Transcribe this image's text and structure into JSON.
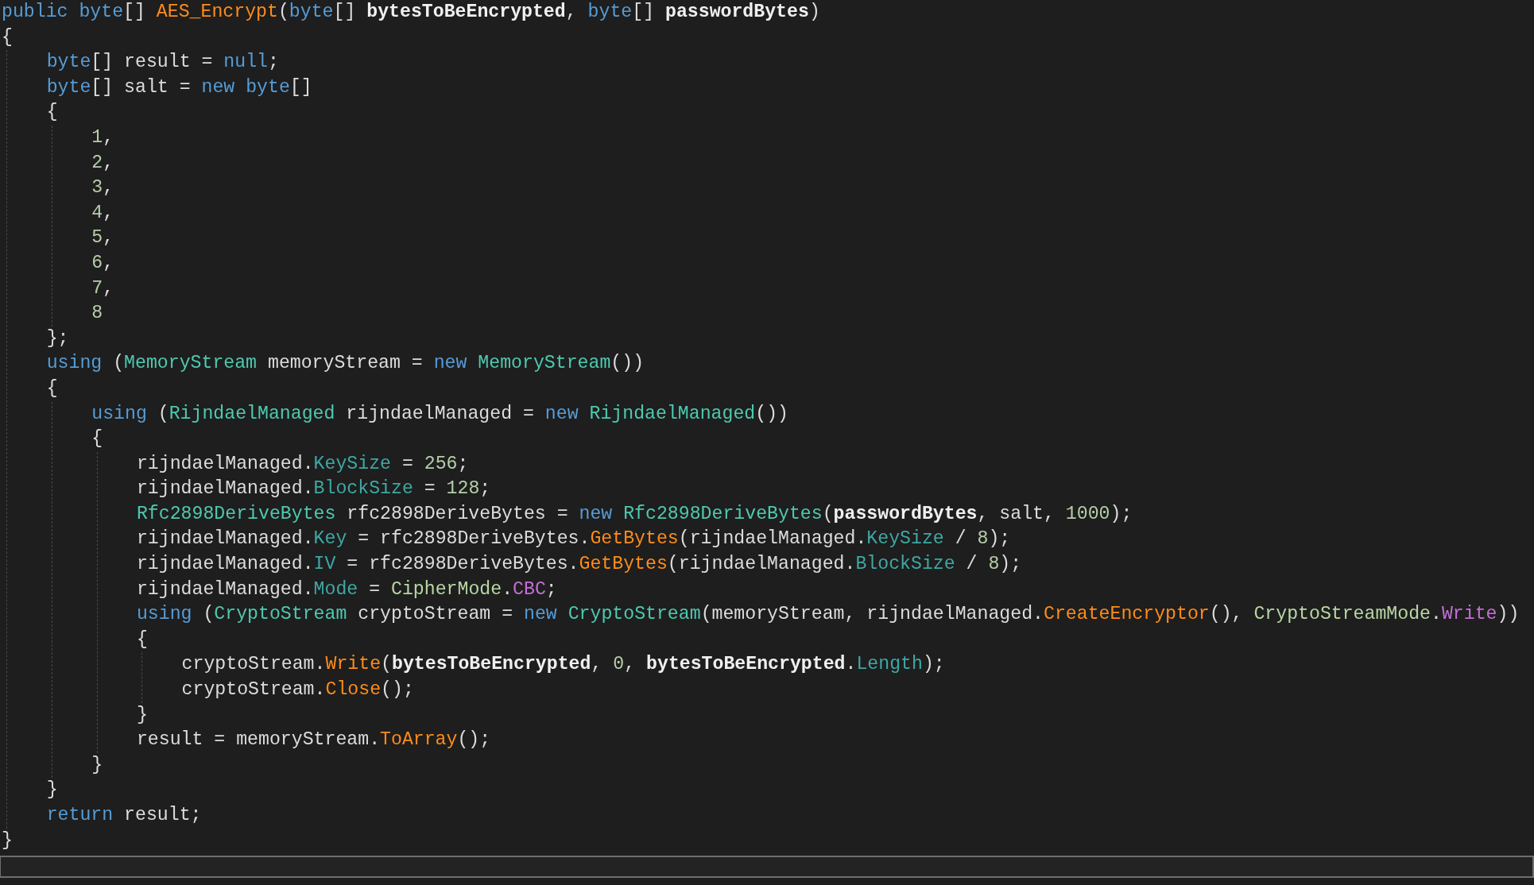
{
  "editor": {
    "lines": [
      {
        "tokens": [
          {
            "kind": "kw",
            "text": "public "
          },
          {
            "kind": "kw",
            "text": "byte"
          },
          {
            "kind": "text",
            "text": "[] "
          },
          {
            "kind": "fn",
            "text": "AES_Encrypt"
          },
          {
            "kind": "text",
            "text": "("
          },
          {
            "kind": "kw",
            "text": "byte"
          },
          {
            "kind": "text",
            "text": "[] "
          },
          {
            "kind": "param",
            "text": "bytesToBeEncrypted"
          },
          {
            "kind": "text",
            "text": ", "
          },
          {
            "kind": "kw",
            "text": "byte"
          },
          {
            "kind": "text",
            "text": "[] "
          },
          {
            "kind": "param",
            "text": "passwordBytes"
          },
          {
            "kind": "text",
            "text": ")"
          }
        ]
      },
      {
        "tokens": [
          {
            "kind": "text",
            "text": "{"
          }
        ],
        "children": [
          {
            "tokens": [
              {
                "kind": "kw",
                "text": "byte"
              },
              {
                "kind": "text",
                "text": "[] result = "
              },
              {
                "kind": "kw",
                "text": "null"
              },
              {
                "kind": "text",
                "text": ";"
              }
            ]
          },
          {
            "tokens": [
              {
                "kind": "kw",
                "text": "byte"
              },
              {
                "kind": "text",
                "text": "[] salt = "
              },
              {
                "kind": "kw",
                "text": "new "
              },
              {
                "kind": "kw",
                "text": "byte"
              },
              {
                "kind": "text",
                "text": "[]"
              }
            ]
          },
          {
            "tokens": [
              {
                "kind": "text",
                "text": "{"
              }
            ],
            "children": [
              {
                "tokens": [
                  {
                    "kind": "num",
                    "text": "1"
                  },
                  {
                    "kind": "text",
                    "text": ","
                  }
                ]
              },
              {
                "tokens": [
                  {
                    "kind": "num",
                    "text": "2"
                  },
                  {
                    "kind": "text",
                    "text": ","
                  }
                ]
              },
              {
                "tokens": [
                  {
                    "kind": "num",
                    "text": "3"
                  },
                  {
                    "kind": "text",
                    "text": ","
                  }
                ]
              },
              {
                "tokens": [
                  {
                    "kind": "num",
                    "text": "4"
                  },
                  {
                    "kind": "text",
                    "text": ","
                  }
                ]
              },
              {
                "tokens": [
                  {
                    "kind": "num",
                    "text": "5"
                  },
                  {
                    "kind": "text",
                    "text": ","
                  }
                ]
              },
              {
                "tokens": [
                  {
                    "kind": "num",
                    "text": "6"
                  },
                  {
                    "kind": "text",
                    "text": ","
                  }
                ]
              },
              {
                "tokens": [
                  {
                    "kind": "num",
                    "text": "7"
                  },
                  {
                    "kind": "text",
                    "text": ","
                  }
                ]
              },
              {
                "tokens": [
                  {
                    "kind": "num",
                    "text": "8"
                  }
                ]
              }
            ]
          },
          {
            "tokens": [
              {
                "kind": "text",
                "text": "};"
              }
            ]
          },
          {
            "tokens": [
              {
                "kind": "kw",
                "text": "using"
              },
              {
                "kind": "text",
                "text": " ("
              },
              {
                "kind": "type",
                "text": "MemoryStream"
              },
              {
                "kind": "text",
                "text": " memoryStream = "
              },
              {
                "kind": "kw",
                "text": "new "
              },
              {
                "kind": "type",
                "text": "MemoryStream"
              },
              {
                "kind": "text",
                "text": "())"
              }
            ]
          },
          {
            "tokens": [
              {
                "kind": "text",
                "text": "{"
              }
            ],
            "children": [
              {
                "tokens": [
                  {
                    "kind": "kw",
                    "text": "using"
                  },
                  {
                    "kind": "text",
                    "text": " ("
                  },
                  {
                    "kind": "type",
                    "text": "RijndaelManaged"
                  },
                  {
                    "kind": "text",
                    "text": " rijndaelManaged = "
                  },
                  {
                    "kind": "kw",
                    "text": "new "
                  },
                  {
                    "kind": "type",
                    "text": "RijndaelManaged"
                  },
                  {
                    "kind": "text",
                    "text": "())"
                  }
                ]
              },
              {
                "tokens": [
                  {
                    "kind": "text",
                    "text": "{"
                  }
                ],
                "children": [
                  {
                    "tokens": [
                      {
                        "kind": "text",
                        "text": "rijndaelManaged."
                      },
                      {
                        "kind": "prop",
                        "text": "KeySize"
                      },
                      {
                        "kind": "text",
                        "text": " = "
                      },
                      {
                        "kind": "num",
                        "text": "256"
                      },
                      {
                        "kind": "text",
                        "text": ";"
                      }
                    ]
                  },
                  {
                    "tokens": [
                      {
                        "kind": "text",
                        "text": "rijndaelManaged."
                      },
                      {
                        "kind": "prop",
                        "text": "BlockSize"
                      },
                      {
                        "kind": "text",
                        "text": " = "
                      },
                      {
                        "kind": "num",
                        "text": "128"
                      },
                      {
                        "kind": "text",
                        "text": ";"
                      }
                    ]
                  },
                  {
                    "tokens": [
                      {
                        "kind": "type",
                        "text": "Rfc2898DeriveBytes"
                      },
                      {
                        "kind": "text",
                        "text": " rfc2898DeriveBytes = "
                      },
                      {
                        "kind": "kw",
                        "text": "new "
                      },
                      {
                        "kind": "type",
                        "text": "Rfc2898DeriveBytes"
                      },
                      {
                        "kind": "text",
                        "text": "("
                      },
                      {
                        "kind": "param",
                        "text": "passwordBytes"
                      },
                      {
                        "kind": "text",
                        "text": ", salt, "
                      },
                      {
                        "kind": "num",
                        "text": "1000"
                      },
                      {
                        "kind": "text",
                        "text": ");"
                      }
                    ]
                  },
                  {
                    "tokens": [
                      {
                        "kind": "text",
                        "text": "rijndaelManaged."
                      },
                      {
                        "kind": "prop",
                        "text": "Key"
                      },
                      {
                        "kind": "text",
                        "text": " = rfc2898DeriveBytes."
                      },
                      {
                        "kind": "fn",
                        "text": "GetBytes"
                      },
                      {
                        "kind": "text",
                        "text": "(rijndaelManaged."
                      },
                      {
                        "kind": "prop",
                        "text": "KeySize"
                      },
                      {
                        "kind": "text",
                        "text": " / "
                      },
                      {
                        "kind": "num",
                        "text": "8"
                      },
                      {
                        "kind": "text",
                        "text": ");"
                      }
                    ]
                  },
                  {
                    "tokens": [
                      {
                        "kind": "text",
                        "text": "rijndaelManaged."
                      },
                      {
                        "kind": "prop",
                        "text": "IV"
                      },
                      {
                        "kind": "text",
                        "text": " = rfc2898DeriveBytes."
                      },
                      {
                        "kind": "fn",
                        "text": "GetBytes"
                      },
                      {
                        "kind": "text",
                        "text": "(rijndaelManaged."
                      },
                      {
                        "kind": "prop",
                        "text": "BlockSize"
                      },
                      {
                        "kind": "text",
                        "text": " / "
                      },
                      {
                        "kind": "num",
                        "text": "8"
                      },
                      {
                        "kind": "text",
                        "text": ");"
                      }
                    ]
                  },
                  {
                    "tokens": [
                      {
                        "kind": "text",
                        "text": "rijndaelManaged."
                      },
                      {
                        "kind": "prop",
                        "text": "Mode"
                      },
                      {
                        "kind": "text",
                        "text": " = "
                      },
                      {
                        "kind": "enumtype",
                        "text": "CipherMode"
                      },
                      {
                        "kind": "text",
                        "text": "."
                      },
                      {
                        "kind": "enum",
                        "text": "CBC"
                      },
                      {
                        "kind": "text",
                        "text": ";"
                      }
                    ]
                  },
                  {
                    "tokens": [
                      {
                        "kind": "kw",
                        "text": "using"
                      },
                      {
                        "kind": "text",
                        "text": " ("
                      },
                      {
                        "kind": "type",
                        "text": "CryptoStream"
                      },
                      {
                        "kind": "text",
                        "text": " cryptoStream = "
                      },
                      {
                        "kind": "kw",
                        "text": "new "
                      },
                      {
                        "kind": "type",
                        "text": "CryptoStream"
                      },
                      {
                        "kind": "text",
                        "text": "(memoryStream, rijndaelManaged."
                      },
                      {
                        "kind": "fn",
                        "text": "CreateEncryptor"
                      },
                      {
                        "kind": "text",
                        "text": "(), "
                      },
                      {
                        "kind": "enumtype",
                        "text": "CryptoStreamMode"
                      },
                      {
                        "kind": "text",
                        "text": "."
                      },
                      {
                        "kind": "enum",
                        "text": "Write"
                      },
                      {
                        "kind": "text",
                        "text": "))"
                      }
                    ]
                  },
                  {
                    "tokens": [
                      {
                        "kind": "text",
                        "text": "{"
                      }
                    ],
                    "children": [
                      {
                        "tokens": [
                          {
                            "kind": "text",
                            "text": "cryptoStream."
                          },
                          {
                            "kind": "fn",
                            "text": "Write"
                          },
                          {
                            "kind": "text",
                            "text": "("
                          },
                          {
                            "kind": "param",
                            "text": "bytesToBeEncrypted"
                          },
                          {
                            "kind": "text",
                            "text": ", "
                          },
                          {
                            "kind": "num",
                            "text": "0"
                          },
                          {
                            "kind": "text",
                            "text": ", "
                          },
                          {
                            "kind": "param",
                            "text": "bytesToBeEncrypted"
                          },
                          {
                            "kind": "text",
                            "text": "."
                          },
                          {
                            "kind": "prop",
                            "text": "Length"
                          },
                          {
                            "kind": "text",
                            "text": ");"
                          }
                        ]
                      },
                      {
                        "tokens": [
                          {
                            "kind": "text",
                            "text": "cryptoStream."
                          },
                          {
                            "kind": "fn",
                            "text": "Close"
                          },
                          {
                            "kind": "text",
                            "text": "();"
                          }
                        ]
                      }
                    ]
                  },
                  {
                    "tokens": [
                      {
                        "kind": "text",
                        "text": "}"
                      }
                    ]
                  },
                  {
                    "tokens": [
                      {
                        "kind": "text",
                        "text": "result = memoryStream."
                      },
                      {
                        "kind": "fn",
                        "text": "ToArray"
                      },
                      {
                        "kind": "text",
                        "text": "();"
                      }
                    ]
                  }
                ]
              },
              {
                "tokens": [
                  {
                    "kind": "text",
                    "text": "}"
                  }
                ]
              }
            ]
          },
          {
            "tokens": [
              {
                "kind": "text",
                "text": "}"
              }
            ]
          },
          {
            "tokens": [
              {
                "kind": "kw",
                "text": "return"
              },
              {
                "kind": "text",
                "text": " result;"
              }
            ]
          }
        ]
      },
      {
        "tokens": [
          {
            "kind": "text",
            "text": "}"
          }
        ]
      }
    ]
  }
}
